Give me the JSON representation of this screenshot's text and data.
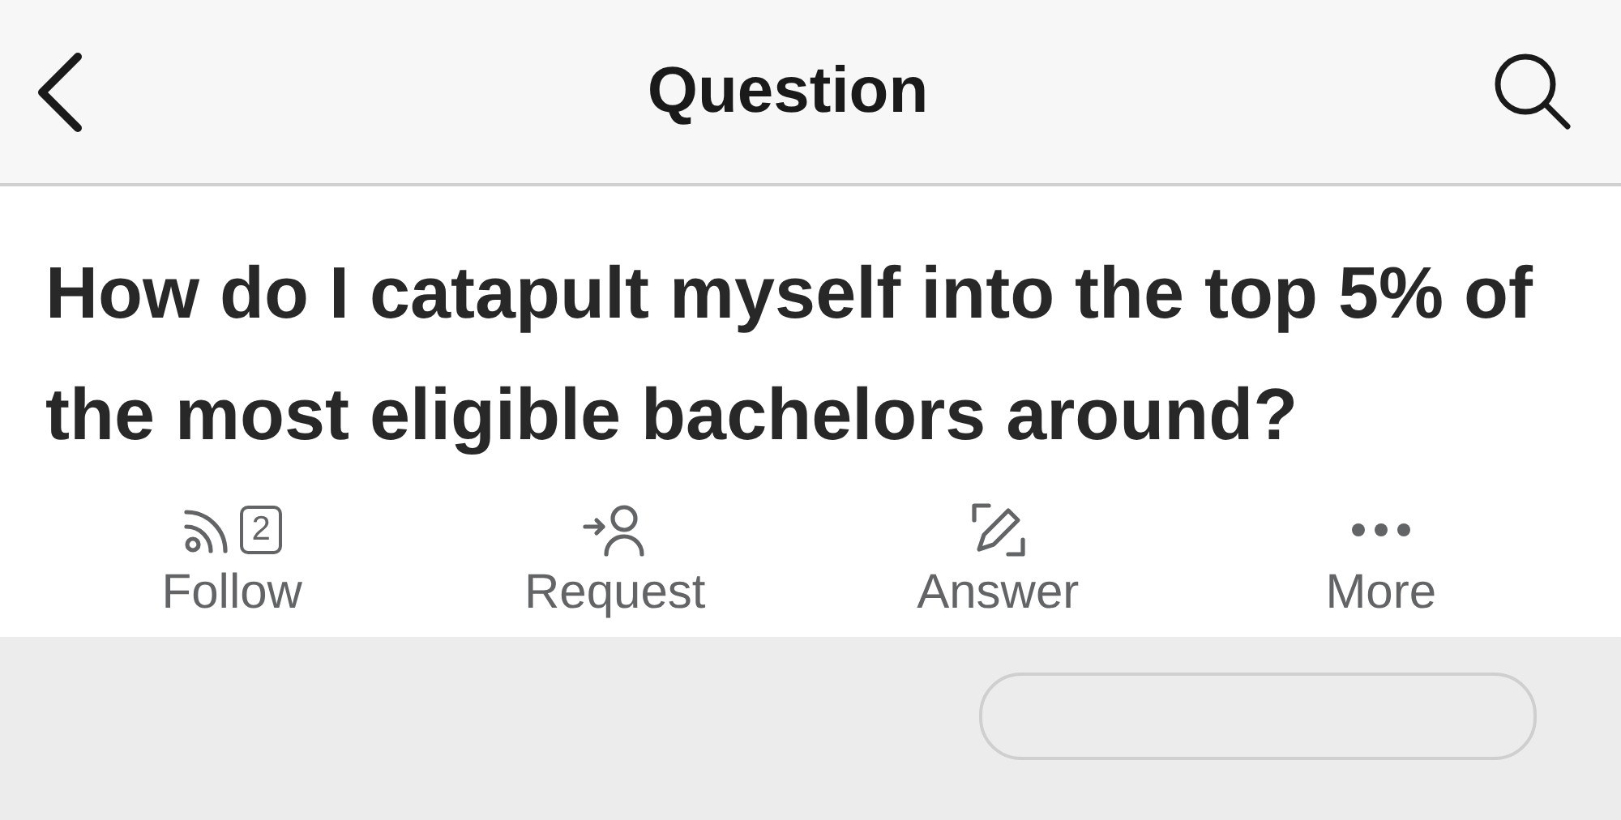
{
  "header": {
    "title": "Question"
  },
  "question": {
    "title": "How do I catapult myself into the top 5% of the most eligible bachelors around?"
  },
  "actions": [
    {
      "kind": "follow",
      "label": "Follow",
      "count": "2"
    },
    {
      "kind": "request",
      "label": "Request"
    },
    {
      "kind": "answer",
      "label": "Answer"
    },
    {
      "kind": "more",
      "label": "More"
    }
  ]
}
